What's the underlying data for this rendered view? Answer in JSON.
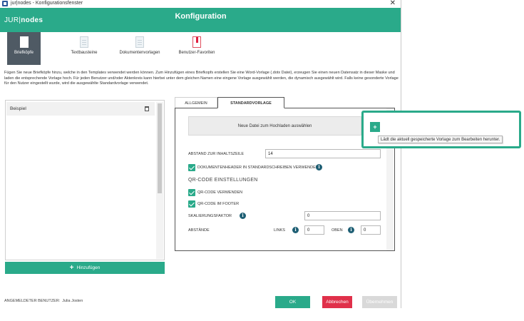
{
  "window": {
    "title": "jur|nodes - Konfigurationsfenster",
    "close_glyph": "✕",
    "app_icon": "word-icon"
  },
  "header": {
    "logo_prefix": "JUR|",
    "logo_suffix": "nodes",
    "title": "Konfiguration",
    "color": "#2aaa8a"
  },
  "nav": {
    "items": [
      {
        "label": "Briefköpfe",
        "icon": "document-icon",
        "active": true
      },
      {
        "label": "Textbausteine",
        "icon": "document-icon",
        "active": false
      },
      {
        "label": "Dokumentenvorlagen",
        "icon": "document-icon",
        "active": false
      },
      {
        "label": "Benutzer-Favoriten",
        "icon": "bookmark-document-icon",
        "active": false
      }
    ]
  },
  "description": "Fügen Sie neue Briefköpfe hinzu, welche in den Templates verwendet werden können. Zum Hinzufügen eines Briefkopfs erstellen Sie eine Word-Vorlage (.dotx Datei), erzeugen Sie einen neuen Datensatz in dieser Maske und laden die entsprechende Vorlage hoch. Für jeden Benutzer und/oder Aktenkreis kann hierbei unter dem gleichen Namen eine eingene Vorlage ausgewählt werden, die dynamisch ausgewählt wird. Falls keine gesonderte Vorlage für den Nutzer eingestellt wurde, wird die ausgewählte Standardvorlage verwendet.",
  "list": {
    "items": [
      {
        "label": "Beispiel"
      }
    ],
    "add_label": "Hinzufügen"
  },
  "tabs": [
    {
      "label": "Allgemein",
      "active": false
    },
    {
      "label": "Standardvorlage",
      "active": true
    }
  ],
  "form": {
    "upload_label": "Neue Datei zum Hochladen auswählen",
    "abstand_label": "Abstand zur Inhaltszeile",
    "abstand_value": "14",
    "doc_header_label": "Dokumentenheader in Standardschreiben verwenden",
    "qr_section": "QR-Code Einstellungen",
    "qr_use_label": "QR-Code verwenden",
    "qr_footer_label": "QR-Code im Footer",
    "scale_label": "Skalierungsfaktor",
    "scale_value": "0",
    "abstaende_label": "Abstände",
    "links_label": "Links",
    "links_value": "0",
    "oben_label": "Oben",
    "oben_value": "0",
    "info_glyph": "i"
  },
  "download": {
    "plus_glyph": "+",
    "tooltip": "Lädt die aktuell gespeicherte Vorlage zum Bearbeiten herunter."
  },
  "footer": {
    "user_label": "Angemeldeter Benutzer:",
    "user_name": "Julia Josten",
    "ok": "OK",
    "cancel": "Abbrechen",
    "apply": "Übernehmen"
  }
}
